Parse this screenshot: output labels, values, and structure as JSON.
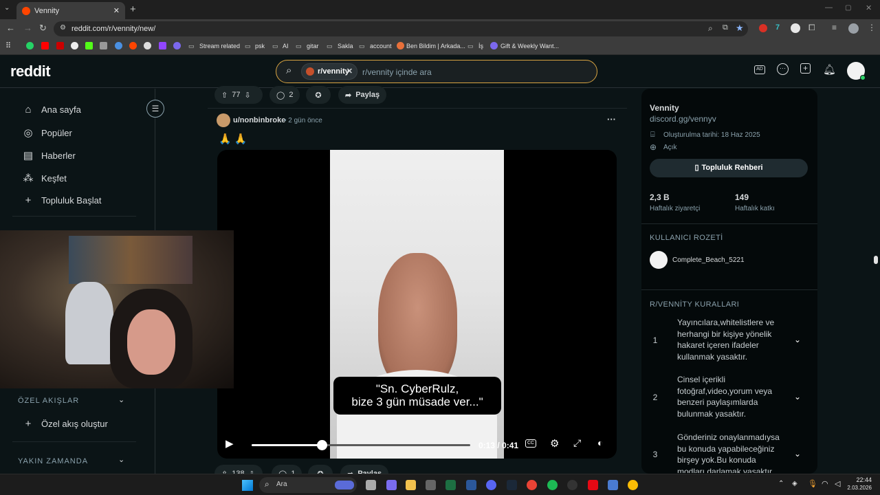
{
  "browser": {
    "tab_title": "Vennity",
    "url": "reddit.com/r/vennity/new/",
    "bookmarks": [
      "Stream related",
      "psk",
      "AI",
      "gitar",
      "Sakla",
      "account",
      "Ben Bildim | Arkada...",
      "İş",
      "Gift & Weekly Want..."
    ]
  },
  "header": {
    "logo": "reddit",
    "search_chip": "r/vennity",
    "search_placeholder": "r/vennity içinde ara"
  },
  "leftnav": {
    "items": [
      {
        "label": "Ana sayfa",
        "icon": "home-icon"
      },
      {
        "label": "Popüler",
        "icon": "popular-icon"
      },
      {
        "label": "Haberler",
        "icon": "news-icon"
      },
      {
        "label": "Keşfet",
        "icon": "explore-icon"
      },
      {
        "label": "Topluluk Başlat",
        "icon": "plus-icon"
      }
    ],
    "custom_feeds_heading": "ÖZEL AKIŞLAR",
    "create_feed": "Özel akış oluştur",
    "recent_heading": "YAKIN ZAMANDA"
  },
  "prev_post": {
    "votes": "77",
    "comments": "2",
    "share": "Paylaş"
  },
  "post": {
    "author": "u/nonbinbroke",
    "time": "2 gün önce",
    "body": "🙏 🙏",
    "caption_line1": "\"Sn. CyberRulz,",
    "caption_line2": "bize 3 gün müsade ver...\"",
    "time_display": "0:13 / 0:41",
    "progress": 0.32
  },
  "next_post": {
    "votes": "138",
    "comments": "1",
    "share": "Paylaş"
  },
  "community": {
    "name": "Vennity",
    "link": "discord.gg/vennyv",
    "created": "Oluşturulma tarihi: 18 Haz 2025",
    "visibility": "Açık",
    "guide_button": "Topluluk Rehberi",
    "stats": [
      {
        "value": "2,3 B",
        "label": "Haftalık ziyaretçi"
      },
      {
        "value": "149",
        "label": "Haftalık katkı"
      }
    ],
    "badge_heading": "KULLANICI ROZETİ",
    "badge_user": "Complete_Beach_5221",
    "rules_heading": "R/VENNİTY KURALLARI",
    "rules": [
      {
        "num": "1",
        "text": "Yayıncılara,whitelistlere ve herhangi bir kişiye yönelik hakaret içeren ifadeler kullanmak yasaktır."
      },
      {
        "num": "2",
        "text": "Cinsel içerikli fotoğraf,video,yorum veya benzeri paylaşımlarda bulunmak yasaktır."
      },
      {
        "num": "3",
        "text": "Gönderiniz onaylanmadıysa bu konuda yapabileceğiniz birşey yok.Bu konuda modları darlamak yasaktır."
      }
    ]
  },
  "taskbar": {
    "search": "Ara",
    "time": "22:44",
    "date": "2.03.2026"
  }
}
